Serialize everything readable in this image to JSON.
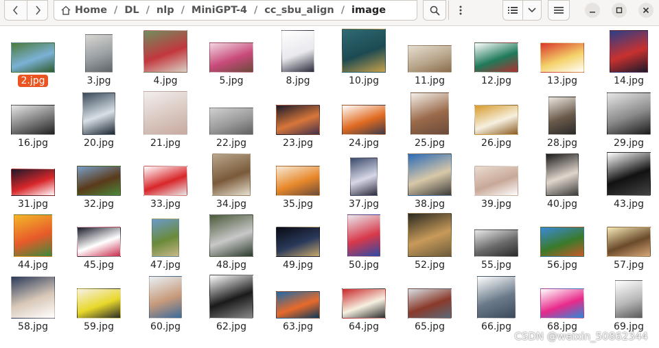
{
  "toolbar": {
    "back_icon": "chevron-left-icon",
    "forward_icon": "chevron-right-icon",
    "breadcrumb": [
      "Home",
      "DL",
      "nlp",
      "MiniGPT-4",
      "cc_sbu_align",
      "image"
    ],
    "separator": "/"
  },
  "files": [
    {
      "name": "2.jpg",
      "selected": true,
      "colors": [
        "#4c7a3a",
        "#7bb1d6",
        "#2f5a2a"
      ]
    },
    {
      "name": "3.jpg",
      "colors": [
        "#d8d6d2",
        "#9aa0a4",
        "#5d6366"
      ]
    },
    {
      "name": "4.jpg",
      "colors": [
        "#6f8f5f",
        "#c2373d",
        "#d9d2c6"
      ]
    },
    {
      "name": "5.jpg",
      "colors": [
        "#f2d7e2",
        "#c84a7a",
        "#6b4a3a"
      ]
    },
    {
      "name": "8.jpg",
      "colors": [
        "#ffffff",
        "#e9e9ee",
        "#2a2a3a"
      ]
    },
    {
      "name": "10.jpg",
      "colors": [
        "#2e6a73",
        "#1d4a52",
        "#c9a24a"
      ]
    },
    {
      "name": "11.jpg",
      "colors": [
        "#e6ddd0",
        "#b8a68c",
        "#8a6b4a"
      ]
    },
    {
      "name": "12.jpg",
      "colors": [
        "#ffffff",
        "#1f7a5a",
        "#b03030"
      ]
    },
    {
      "name": "13.jpg",
      "colors": [
        "#d8362a",
        "#f4d26a",
        "#ffffff"
      ]
    },
    {
      "name": "14.jpg",
      "colors": [
        "#2a3f8a",
        "#c8312f",
        "#1a1a2a"
      ]
    },
    {
      "name": "16.jpg",
      "colors": [
        "#e6e6e6",
        "#7a7a7a",
        "#202020"
      ]
    },
    {
      "name": "20.jpg",
      "colors": [
        "#3a4a5a",
        "#d8e0e6",
        "#1a2430"
      ]
    },
    {
      "name": "21.jpg",
      "colors": [
        "#f2eeee",
        "#d9c8c0",
        "#c7a9a0"
      ]
    },
    {
      "name": "22.jpg",
      "colors": [
        "#d0d0d0",
        "#9a9a9a",
        "#5f5f5f"
      ]
    },
    {
      "name": "23.jpg",
      "colors": [
        "#1a1a2a",
        "#d8763a",
        "#40304a"
      ]
    },
    {
      "name": "24.jpg",
      "colors": [
        "#ffffff",
        "#e06a20",
        "#3a3a4a"
      ]
    },
    {
      "name": "25.jpg",
      "colors": [
        "#f4f0ea",
        "#9a6a4a",
        "#6a4a3a"
      ]
    },
    {
      "name": "26.jpg",
      "colors": [
        "#d69a2a",
        "#f6f0e0",
        "#8a5a20"
      ]
    },
    {
      "name": "28.jpg",
      "colors": [
        "#ece7e2",
        "#6a5a4a",
        "#2a2a2a"
      ]
    },
    {
      "name": "29.jpg",
      "colors": [
        "#e6e6e6",
        "#8a8a8a",
        "#1a1a1a"
      ]
    },
    {
      "name": "31.jpg",
      "colors": [
        "#1a1a2a",
        "#d8262a",
        "#ffffff"
      ]
    },
    {
      "name": "32.jpg",
      "colors": [
        "#7aa0c8",
        "#5a3a1a",
        "#4a8a3a"
      ]
    },
    {
      "name": "33.jpg",
      "colors": [
        "#ffffff",
        "#d8262a",
        "#e8e8e8"
      ]
    },
    {
      "name": "34.jpg",
      "colors": [
        "#b8a68c",
        "#7a5a3a",
        "#e8e0d0"
      ]
    },
    {
      "name": "35.jpg",
      "colors": [
        "#f6ead6",
        "#e8882a",
        "#6a4a3a"
      ]
    },
    {
      "name": "37.jpg",
      "colors": [
        "#3a4a6a",
        "#d8d8e8",
        "#2a2a3a"
      ]
    },
    {
      "name": "38.jpg",
      "colors": [
        "#2a6ab8",
        "#d8c8a8",
        "#3a3a3a"
      ]
    },
    {
      "name": "39.jpg",
      "colors": [
        "#eadcd0",
        "#c8a898",
        "#ffffff"
      ]
    },
    {
      "name": "40.jpg",
      "colors": [
        "#1a1a1a",
        "#e0d6cc",
        "#3a3a3a"
      ]
    },
    {
      "name": "43.jpg",
      "colors": [
        "#ffffff",
        "#111111",
        "#444444"
      ]
    },
    {
      "name": "44.jpg",
      "colors": [
        "#f2b82a",
        "#e85a2a",
        "#3a8a3a"
      ]
    },
    {
      "name": "45.jpg",
      "colors": [
        "#1a1a2a",
        "#ffffff",
        "#c82a4a"
      ]
    },
    {
      "name": "47.jpg",
      "colors": [
        "#6a9ac8",
        "#6a8a3a",
        "#c8b88a"
      ]
    },
    {
      "name": "48.jpg",
      "colors": [
        "#4a5a3a",
        "#c8c8c8",
        "#2a3a2a"
      ]
    },
    {
      "name": "49.jpg",
      "colors": [
        "#0a0a14",
        "#2a3a5a",
        "#c8a86a"
      ]
    },
    {
      "name": "50.jpg",
      "colors": [
        "#e8e8ec",
        "#d8384a",
        "#2a4aa8"
      ]
    },
    {
      "name": "52.jpg",
      "colors": [
        "#2a2a20",
        "#c89a5a",
        "#6a5a3a"
      ]
    },
    {
      "name": "55.jpg",
      "colors": [
        "#e8e8e8",
        "#6a6a6a",
        "#2a2a2a"
      ]
    },
    {
      "name": "56.jpg",
      "colors": [
        "#3a8ad8",
        "#3a7a2a",
        "#c85a2a"
      ]
    },
    {
      "name": "57.jpg",
      "colors": [
        "#f6eab8",
        "#6a4a2a",
        "#d8a87a"
      ]
    },
    {
      "name": "58.jpg",
      "colors": [
        "#2a3a5a",
        "#d8c8b8",
        "#ffffff"
      ]
    },
    {
      "name": "59.jpg",
      "colors": [
        "#f6f0e8",
        "#e8d82a",
        "#2a2a2a"
      ]
    },
    {
      "name": "60.jpg",
      "colors": [
        "#e8f0f6",
        "#c89a7a",
        "#3a6a9a"
      ]
    },
    {
      "name": "62.jpg",
      "colors": [
        "#ffffff",
        "#1a1a1a",
        "#888888"
      ]
    },
    {
      "name": "63.jpg",
      "colors": [
        "#1a6aa8",
        "#e86a2a",
        "#0a3a5a"
      ]
    },
    {
      "name": "64.jpg",
      "colors": [
        "#c8262a",
        "#f6f0e0",
        "#2a2a2a"
      ]
    },
    {
      "name": "65.jpg",
      "colors": [
        "#d8e0e6",
        "#8a3a2a",
        "#5a6a7a"
      ]
    },
    {
      "name": "66.jpg",
      "colors": [
        "#ffffff",
        "#6a7a8a",
        "#3a4a5a"
      ]
    },
    {
      "name": "68.jpg",
      "colors": [
        "#ffffff",
        "#e82a8a",
        "#2a8ad8"
      ]
    },
    {
      "name": "69.jpg",
      "colors": [
        "#ffffff",
        "#b8b8b8",
        "#5a5a5a"
      ]
    }
  ],
  "watermark": "CSDN @weixin_50862344"
}
